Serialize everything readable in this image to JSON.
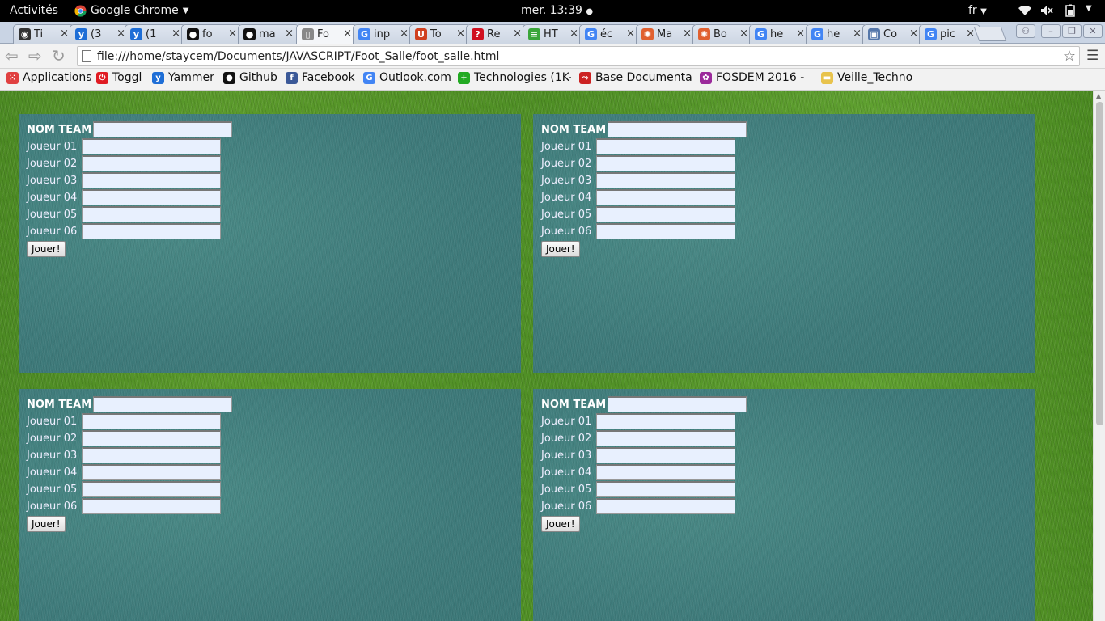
{
  "topbar": {
    "activities": "Activités",
    "app_name": "Google Chrome",
    "clock": "mer. 13:39",
    "lang": "fr"
  },
  "tabs": [
    {
      "title": "Ti",
      "color": "#333333",
      "glyph": "◉"
    },
    {
      "title": "(3",
      "color": "#1e6ed6",
      "glyph": "y"
    },
    {
      "title": "(1",
      "color": "#1e6ed6",
      "glyph": "y"
    },
    {
      "title": "fo",
      "color": "#111111",
      "glyph": "●"
    },
    {
      "title": "ma",
      "color": "#111111",
      "glyph": "●"
    },
    {
      "title": "Fo",
      "color": "#888888",
      "glyph": "▯"
    },
    {
      "title": "inp",
      "color": "#4285f4",
      "glyph": "G"
    },
    {
      "title": "To",
      "color": "#d04020",
      "glyph": "U"
    },
    {
      "title": "Re",
      "color": "#d01020",
      "glyph": "?"
    },
    {
      "title": "HT",
      "color": "#3aa63a",
      "glyph": "≡"
    },
    {
      "title": "éc",
      "color": "#4285f4",
      "glyph": "G"
    },
    {
      "title": "Ma",
      "color": "#e06030",
      "glyph": "✺"
    },
    {
      "title": "Bo",
      "color": "#e06030",
      "glyph": "✺"
    },
    {
      "title": "he",
      "color": "#4285f4",
      "glyph": "G"
    },
    {
      "title": "he",
      "color": "#4285f4",
      "glyph": "G"
    },
    {
      "title": "Co",
      "color": "#5577aa",
      "glyph": "▣"
    },
    {
      "title": "pic",
      "color": "#4285f4",
      "glyph": "G"
    }
  ],
  "toolbar": {
    "url": "file:///home/staycem/Documents/JAVASCRIPT/Foot_Salle/foot_salle.html"
  },
  "bookmarks": [
    {
      "label": "Applications",
      "color": "#e04040",
      "glyph": "⁙"
    },
    {
      "label": "Toggl",
      "color": "#e01b22",
      "glyph": "⏻"
    },
    {
      "label": "Yammer",
      "color": "#1e6ed6",
      "glyph": "y"
    },
    {
      "label": "Github",
      "color": "#111111",
      "glyph": "●"
    },
    {
      "label": "Facebook",
      "color": "#3b5998",
      "glyph": "f"
    },
    {
      "label": "Outlook.com",
      "color": "#4285f4",
      "glyph": "G"
    },
    {
      "label": "Technologies (1K-",
      "color": "#22aa22",
      "glyph": "+"
    },
    {
      "label": "Base Documentai",
      "color": "#cc2222",
      "glyph": "⤳"
    },
    {
      "label": "FOSDEM 2016 -",
      "color": "#9b2a9b",
      "glyph": "✿"
    },
    {
      "label": "Veille_Techno",
      "color": "#e8c34c",
      "glyph": "▬"
    }
  ],
  "form": {
    "team_label": "NOM TEAM",
    "players": [
      "Joueur 01",
      "Joueur 02",
      "Joueur 03",
      "Joueur 04",
      "Joueur 05",
      "Joueur 06"
    ],
    "play_button": "Jouer!"
  }
}
